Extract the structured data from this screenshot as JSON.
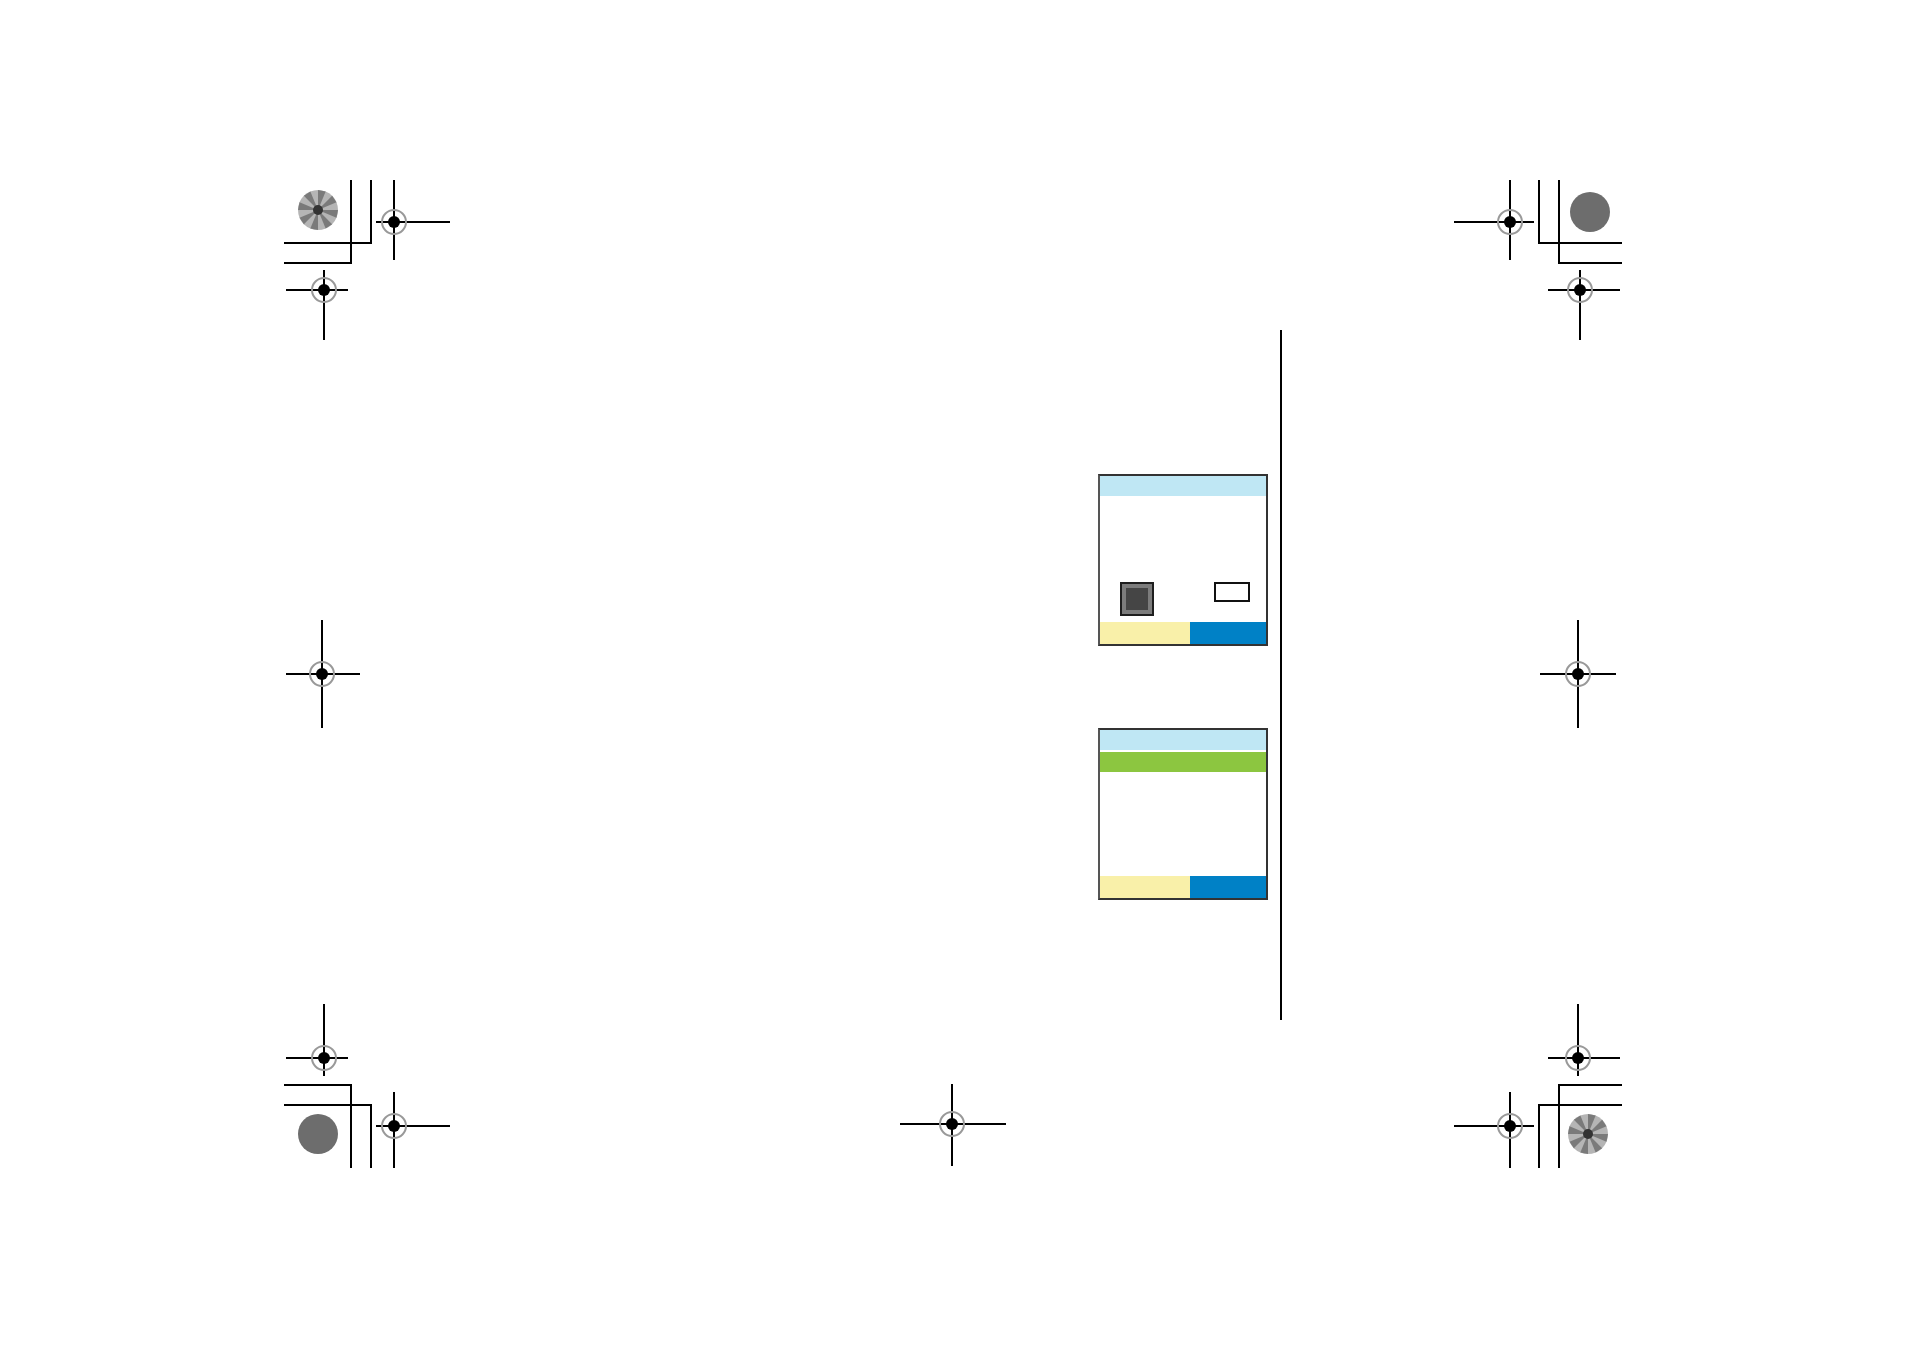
{
  "screens": [
    {
      "kind": "dialog"
    },
    {
      "kind": "list"
    }
  ]
}
